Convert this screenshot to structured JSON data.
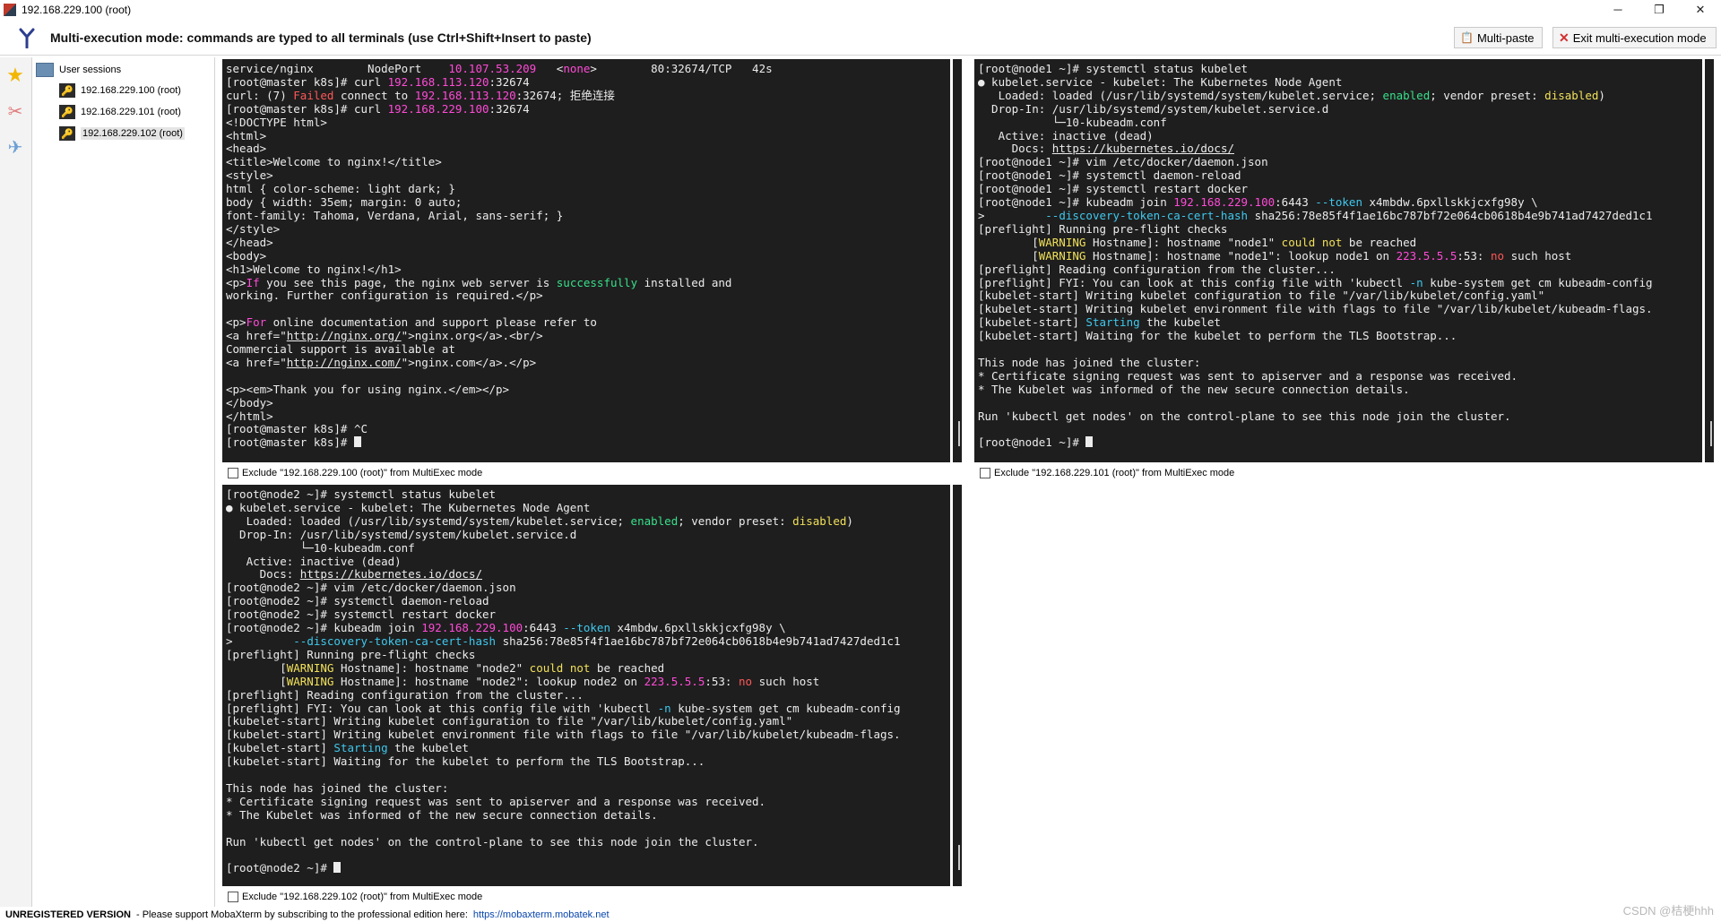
{
  "window": {
    "title": "192.168.229.100 (root)",
    "controls": [
      "─",
      "❐",
      "✕"
    ]
  },
  "toolbar": {
    "mode_text": "Multi-execution mode: commands are typed to all terminals (use Ctrl+Shift+Insert to paste)",
    "multipaste_label": "Multi-paste",
    "exit_label": "Exit multi-execution mode"
  },
  "sidebar": {
    "root_label": "User sessions",
    "sessions": [
      {
        "label": "192.168.229.100 (root)"
      },
      {
        "label": "192.168.229.101 (root)"
      },
      {
        "label": "192.168.229.102 (root)"
      }
    ]
  },
  "terminals": [
    {
      "exclude_label": "Exclude \"192.168.229.100 (root)\" from MultiExec mode",
      "lines": [
        [
          [
            "service/nginx        NodePort    ",
            ""
          ],
          [
            "10.107.53.209",
            "pink"
          ],
          [
            "   <",
            ""
          ],
          [
            "none",
            "pink"
          ],
          [
            ">        80:32674/TCP   42s",
            ""
          ]
        ],
        [
          [
            "[root@master k8s]# curl ",
            ""
          ],
          [
            "192.168.113.120",
            "pink"
          ],
          [
            ":32674",
            ""
          ]
        ],
        [
          [
            "curl: (7) ",
            ""
          ],
          [
            "Failed",
            "red"
          ],
          [
            " connect to ",
            ""
          ],
          [
            "192.168.113.120",
            "pink"
          ],
          [
            ":32674; 拒绝连接",
            ""
          ]
        ],
        [
          [
            "[root@master k8s]# curl ",
            ""
          ],
          [
            "192.168.229.100",
            "pink"
          ],
          [
            ":32674",
            ""
          ]
        ],
        [
          [
            "<!DOCTYPE html>",
            ""
          ]
        ],
        [
          [
            "<html>",
            ""
          ]
        ],
        [
          [
            "<head>",
            ""
          ]
        ],
        [
          [
            "<title>Welcome to nginx!</title>",
            ""
          ]
        ],
        [
          [
            "<style>",
            ""
          ]
        ],
        [
          [
            "html { color-scheme: light dark; }",
            ""
          ]
        ],
        [
          [
            "body { width: 35em; margin: 0 auto;",
            ""
          ]
        ],
        [
          [
            "font-family: Tahoma, Verdana, Arial, sans-serif; }",
            ""
          ]
        ],
        [
          [
            "</style>",
            ""
          ]
        ],
        [
          [
            "</head>",
            ""
          ]
        ],
        [
          [
            "<body>",
            ""
          ]
        ],
        [
          [
            "<h1>Welcome to nginx!</h1>",
            ""
          ]
        ],
        [
          [
            "<p>",
            ""
          ],
          [
            "If",
            "pink"
          ],
          [
            " you see this page, the nginx web server is ",
            ""
          ],
          [
            "successfully",
            "green"
          ],
          [
            " installed and",
            ""
          ]
        ],
        [
          [
            "working. Further configuration is required.</p>",
            ""
          ]
        ],
        [
          [
            "",
            ""
          ]
        ],
        [
          [
            "<p>",
            ""
          ],
          [
            "For",
            "pink"
          ],
          [
            " online documentation and support please refer to",
            ""
          ]
        ],
        [
          [
            "<a href=\"",
            ""
          ],
          [
            "http://nginx.org/",
            "u"
          ],
          [
            "\">nginx.org</a>.<br/>",
            ""
          ]
        ],
        [
          [
            "Commercial support is available at",
            ""
          ]
        ],
        [
          [
            "<a href=\"",
            ""
          ],
          [
            "http://nginx.com/",
            "u"
          ],
          [
            "\">nginx.com</a>.</p>",
            ""
          ]
        ],
        [
          [
            "",
            ""
          ]
        ],
        [
          [
            "<p><em>Thank you for using nginx.</em></p>",
            ""
          ]
        ],
        [
          [
            "</body>",
            ""
          ]
        ],
        [
          [
            "</html>",
            ""
          ]
        ],
        [
          [
            "[root@master k8s]# ^C",
            ""
          ]
        ],
        [
          [
            "[root@master k8s]# ",
            ""
          ],
          [
            "",
            "cursor"
          ]
        ]
      ]
    },
    {
      "exclude_label": "Exclude \"192.168.229.101 (root)\" from MultiExec mode",
      "lines": [
        [
          [
            "[root@node1 ~]# systemctl status kubelet",
            ""
          ]
        ],
        [
          [
            "● kubelet.service - kubelet: The Kubernetes Node Agent",
            ""
          ]
        ],
        [
          [
            "   Loaded: loaded (/usr/lib/systemd/system/kubelet.service; ",
            ""
          ],
          [
            "enabled",
            "green"
          ],
          [
            "; vendor preset: ",
            ""
          ],
          [
            "disabled",
            "yellow"
          ],
          [
            ")",
            ""
          ]
        ],
        [
          [
            "  Drop-In: /usr/lib/systemd/system/kubelet.service.d",
            ""
          ]
        ],
        [
          [
            "           └─10-kubeadm.conf",
            ""
          ]
        ],
        [
          [
            "   Active: inactive (dead)",
            ""
          ]
        ],
        [
          [
            "     Docs: ",
            ""
          ],
          [
            "https://kubernetes.io/docs/",
            "u"
          ]
        ],
        [
          [
            "[root@node1 ~]# vim /etc/docker/daemon.json",
            ""
          ]
        ],
        [
          [
            "[root@node1 ~]# systemctl daemon-reload",
            ""
          ]
        ],
        [
          [
            "[root@node1 ~]# systemctl restart docker",
            ""
          ]
        ],
        [
          [
            "[root@node1 ~]# kubeadm join ",
            ""
          ],
          [
            "192.168.229.100",
            "pink"
          ],
          [
            ":6443 ",
            ""
          ],
          [
            "--token",
            "cyan"
          ],
          [
            " x4mbdw.6pxllskkjcxfg98y \\",
            ""
          ]
        ],
        [
          [
            ">         ",
            ""
          ],
          [
            "--discovery-token-ca-cert-hash",
            "cyan"
          ],
          [
            " sha256:78e85f4f1ae16bc787bf72e064cb0618b4e9b741ad7427ded1c1",
            ""
          ]
        ],
        [
          [
            "[preflight] Running pre-flight checks",
            ""
          ]
        ],
        [
          [
            "        [",
            ""
          ],
          [
            "WARNING",
            "yellow"
          ],
          [
            " Hostname]: hostname \"node1\" ",
            ""
          ],
          [
            "could not",
            "yellow"
          ],
          [
            " be reached",
            ""
          ]
        ],
        [
          [
            "        [",
            ""
          ],
          [
            "WARNING",
            "yellow"
          ],
          [
            " Hostname]: hostname \"node1\": lookup node1 on ",
            ""
          ],
          [
            "223.5.5.5",
            "pink"
          ],
          [
            ":53: ",
            ""
          ],
          [
            "no",
            "red"
          ],
          [
            " such host",
            ""
          ]
        ],
        [
          [
            "[preflight] Reading configuration from the cluster...",
            ""
          ]
        ],
        [
          [
            "[preflight] FYI: You can look at this config file with 'kubectl ",
            ""
          ],
          [
            "-n",
            "cyan"
          ],
          [
            " kube-system get cm kubeadm-config",
            ""
          ]
        ],
        [
          [
            "[kubelet-start] Writing kubelet configuration to file \"/var/lib/kubelet/config.yaml\"",
            ""
          ]
        ],
        [
          [
            "[kubelet-start] Writing kubelet environment file with flags to file \"/var/lib/kubelet/kubeadm-flags.",
            ""
          ]
        ],
        [
          [
            "[kubelet-start] ",
            ""
          ],
          [
            "Starting",
            "cyan"
          ],
          [
            " the kubelet",
            ""
          ]
        ],
        [
          [
            "[kubelet-start] Waiting for the kubelet to perform the TLS Bootstrap...",
            ""
          ]
        ],
        [
          [
            "",
            ""
          ]
        ],
        [
          [
            "This node has joined the cluster:",
            ""
          ]
        ],
        [
          [
            "* Certificate signing request was sent to apiserver and a response was received.",
            ""
          ]
        ],
        [
          [
            "* The Kubelet was informed of the new secure connection details.",
            ""
          ]
        ],
        [
          [
            "",
            ""
          ]
        ],
        [
          [
            "Run 'kubectl get nodes' on the control-plane to see this node join the cluster.",
            ""
          ]
        ],
        [
          [
            "",
            ""
          ]
        ],
        [
          [
            "[root@node1 ~]# ",
            ""
          ],
          [
            "",
            "cursor"
          ]
        ]
      ]
    },
    {
      "exclude_label": "Exclude \"192.168.229.102 (root)\" from MultiExec mode",
      "lines": [
        [
          [
            "[root@node2 ~]# systemctl status kubelet",
            ""
          ]
        ],
        [
          [
            "● kubelet.service - kubelet: The Kubernetes Node Agent",
            ""
          ]
        ],
        [
          [
            "   Loaded: loaded (/usr/lib/systemd/system/kubelet.service; ",
            ""
          ],
          [
            "enabled",
            "green"
          ],
          [
            "; vendor preset: ",
            ""
          ],
          [
            "disabled",
            "yellow"
          ],
          [
            ")",
            ""
          ]
        ],
        [
          [
            "  Drop-In: /usr/lib/systemd/system/kubelet.service.d",
            ""
          ]
        ],
        [
          [
            "           └─10-kubeadm.conf",
            ""
          ]
        ],
        [
          [
            "   Active: inactive (dead)",
            ""
          ]
        ],
        [
          [
            "     Docs: ",
            ""
          ],
          [
            "https://kubernetes.io/docs/",
            "u"
          ]
        ],
        [
          [
            "[root@node2 ~]# vim /etc/docker/daemon.json",
            ""
          ]
        ],
        [
          [
            "[root@node2 ~]# systemctl daemon-reload",
            ""
          ]
        ],
        [
          [
            "[root@node2 ~]# systemctl restart docker",
            ""
          ]
        ],
        [
          [
            "[root@node2 ~]# kubeadm join ",
            ""
          ],
          [
            "192.168.229.100",
            "pink"
          ],
          [
            ":6443 ",
            ""
          ],
          [
            "--token",
            "cyan"
          ],
          [
            " x4mbdw.6pxllskkjcxfg98y \\",
            ""
          ]
        ],
        [
          [
            ">         ",
            ""
          ],
          [
            "--discovery-token-ca-cert-hash",
            "cyan"
          ],
          [
            " sha256:78e85f4f1ae16bc787bf72e064cb0618b4e9b741ad7427ded1c1",
            ""
          ]
        ],
        [
          [
            "[preflight] Running pre-flight checks",
            ""
          ]
        ],
        [
          [
            "        [",
            ""
          ],
          [
            "WARNING",
            "yellow"
          ],
          [
            " Hostname]: hostname \"node2\" ",
            ""
          ],
          [
            "could not",
            "yellow"
          ],
          [
            " be reached",
            ""
          ]
        ],
        [
          [
            "        [",
            ""
          ],
          [
            "WARNING",
            "yellow"
          ],
          [
            " Hostname]: hostname \"node2\": lookup node2 on ",
            ""
          ],
          [
            "223.5.5.5",
            "pink"
          ],
          [
            ":53: ",
            ""
          ],
          [
            "no",
            "red"
          ],
          [
            " such host",
            ""
          ]
        ],
        [
          [
            "[preflight] Reading configuration from the cluster...",
            ""
          ]
        ],
        [
          [
            "[preflight] FYI: You can look at this config file with 'kubectl ",
            ""
          ],
          [
            "-n",
            "cyan"
          ],
          [
            " kube-system get cm kubeadm-config",
            ""
          ]
        ],
        [
          [
            "[kubelet-start] Writing kubelet configuration to file \"/var/lib/kubelet/config.yaml\"",
            ""
          ]
        ],
        [
          [
            "[kubelet-start] Writing kubelet environment file with flags to file \"/var/lib/kubelet/kubeadm-flags.",
            ""
          ]
        ],
        [
          [
            "[kubelet-start] ",
            ""
          ],
          [
            "Starting",
            "cyan"
          ],
          [
            " the kubelet",
            ""
          ]
        ],
        [
          [
            "[kubelet-start] Waiting for the kubelet to perform the TLS Bootstrap...",
            ""
          ]
        ],
        [
          [
            "",
            ""
          ]
        ],
        [
          [
            "This node has joined the cluster:",
            ""
          ]
        ],
        [
          [
            "* Certificate signing request was sent to apiserver and a response was received.",
            ""
          ]
        ],
        [
          [
            "* The Kubelet was informed of the new secure connection details.",
            ""
          ]
        ],
        [
          [
            "",
            ""
          ]
        ],
        [
          [
            "Run 'kubectl get nodes' on the control-plane to see this node join the cluster.",
            ""
          ]
        ],
        [
          [
            "",
            ""
          ]
        ],
        [
          [
            "[root@node2 ~]# ",
            ""
          ],
          [
            "",
            "cursor"
          ]
        ]
      ]
    }
  ],
  "statusbar": {
    "unregistered": "UNREGISTERED VERSION",
    "message": " -  Please support MobaXterm by subscribing to the professional edition here:",
    "link": "https://mobaxterm.mobatek.net"
  },
  "watermark": "CSDN @桔梗hhh",
  "colors": {
    "terminal_bg": "#1e1e1e",
    "terminal_fg": "#ececec",
    "pink": "#ff4ad7",
    "red": "#ff5757",
    "green": "#38e08a",
    "cyan": "#3fc8ee",
    "yellow": "#f1e05a"
  }
}
